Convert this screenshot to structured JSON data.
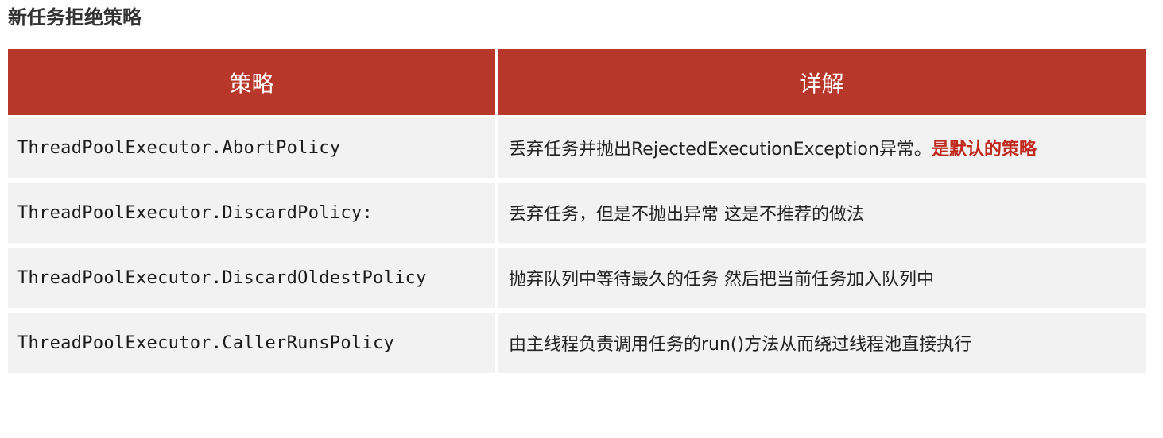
{
  "page": {
    "title": "新任务拒绝策略"
  },
  "table": {
    "headers": [
      "策略",
      "详解"
    ],
    "rows": [
      {
        "policy": "ThreadPoolExecutor.AbortPolicy",
        "detail": "丢弃任务并抛出RejectedExecutionException异常。",
        "highlight": "是默认的策略"
      },
      {
        "policy": "ThreadPoolExecutor.DiscardPolicy:",
        "detail": "丢弃任务，但是不抛出异常 这是不推荐的做法"
      },
      {
        "policy": "ThreadPoolExecutor.DiscardOldestPolicy",
        "detail": "抛弃队列中等待最久的任务 然后把当前任务加入队列中"
      },
      {
        "policy": "ThreadPoolExecutor.CallerRunsPolicy",
        "detail": "由主线程负责调用任务的run()方法从而绕过线程池直接执行"
      }
    ]
  },
  "colors": {
    "header_bg": "#b7382b",
    "row_bg": "#f2f2f2",
    "highlight": "#c0281d"
  }
}
